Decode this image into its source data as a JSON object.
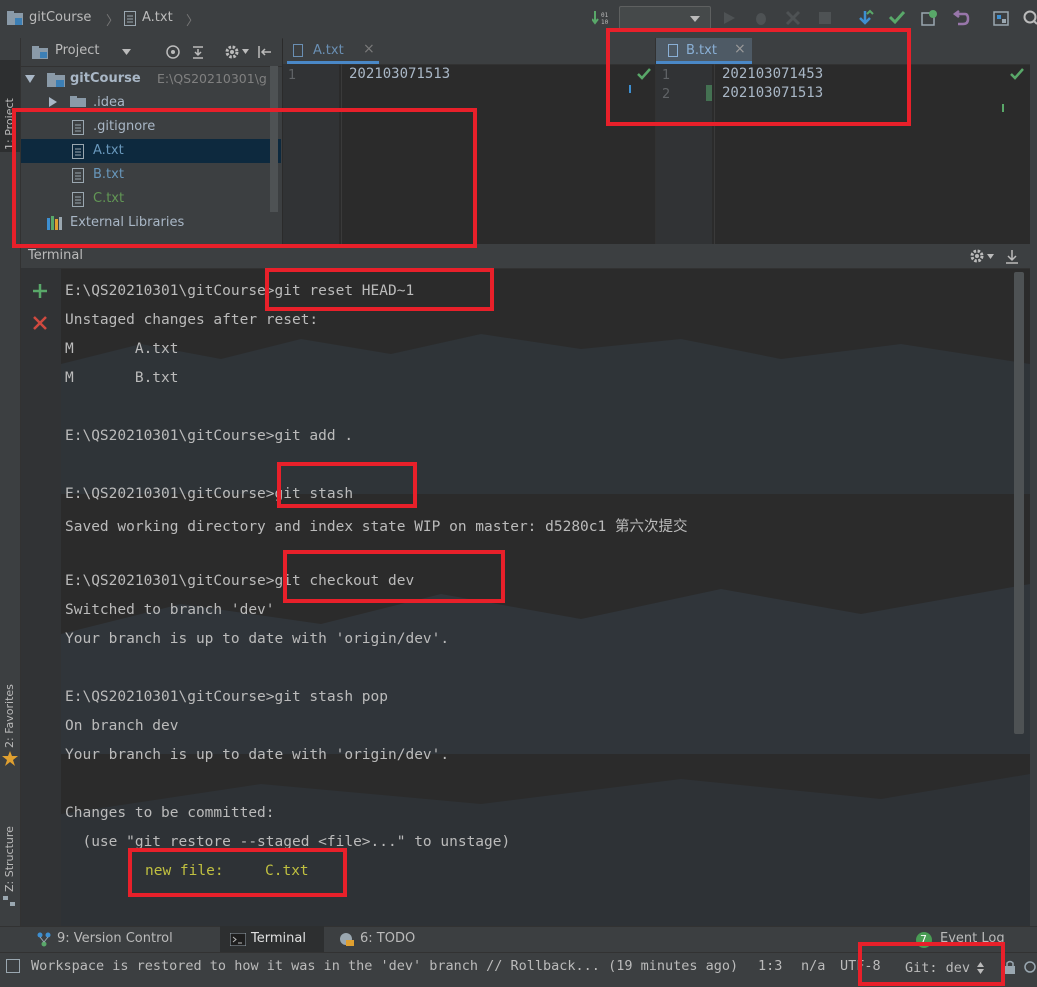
{
  "breadcrumb": {
    "project": "gitCourse",
    "file": "A.txt"
  },
  "project_panel": {
    "header": "Project",
    "root": {
      "name": "gitCourse",
      "path": "E:\\QS20210301\\g"
    },
    "items": [
      {
        "label": ".idea",
        "color": "#a9b7c6"
      },
      {
        "label": ".gitignore",
        "color": "#a9b7c6"
      },
      {
        "label": "A.txt",
        "color": "#6897bb"
      },
      {
        "label": "B.txt",
        "color": "#6897bb"
      },
      {
        "label": "C.txt",
        "color": "#629755"
      },
      {
        "label": "External Libraries",
        "color": "#a9b7c6"
      }
    ]
  },
  "editor_a": {
    "tab": "A.txt",
    "lines": [
      {
        "num": "1",
        "text": "202103071513"
      }
    ]
  },
  "editor_b": {
    "tab": "B.txt",
    "lines": [
      {
        "num": "1",
        "text": "202103071453"
      },
      {
        "num": "2",
        "text": "202103071513"
      }
    ]
  },
  "left_strip": {
    "project": "1: Project",
    "favorites": "2: Favorites",
    "structure": "Z: Structure"
  },
  "terminal": {
    "title": "Terminal",
    "lines": [
      "E:\\QS20210301\\gitCourse>git reset HEAD~1",
      "Unstaged changes after reset:",
      "M       A.txt",
      "M       B.txt",
      "",
      "E:\\QS20210301\\gitCourse>git add .",
      "",
      "E:\\QS20210301\\gitCourse>git stash",
      "Saved working directory and index state WIP on master: d5280c1 第六次提交",
      "",
      "E:\\QS20210301\\gitCourse>git checkout dev",
      "Switched to branch 'dev'",
      "Your branch is up to date with 'origin/dev'.",
      "",
      "E:\\QS20210301\\gitCourse>git stash pop",
      "On branch dev",
      "Your branch is up to date with 'origin/dev'.",
      "",
      "Changes to be committed:",
      "  (use \"git restore --staged <file>...\" to unstage)"
    ],
    "new_file_label": "new file:",
    "new_file_name": "C.txt",
    "new_file_color": "#c0c040"
  },
  "tool_windows": {
    "version_control": "9: Version Control",
    "terminal": "Terminal",
    "todo": "6: TODO",
    "event_log": "Event Log",
    "event_log_count": "7"
  },
  "status_bar": {
    "message": "Workspace is restored to how it was in the 'dev' branch // Rollback... (19 minutes ago)",
    "position": "1:3",
    "separator": "n/a",
    "encoding": "UTF-8",
    "git_branch": "Git: dev"
  },
  "colors": {
    "accent_red": "#e8202a",
    "ide_bg": "#2b2b2b",
    "panel_bg": "#3c3f41",
    "success_green": "#59a869"
  }
}
